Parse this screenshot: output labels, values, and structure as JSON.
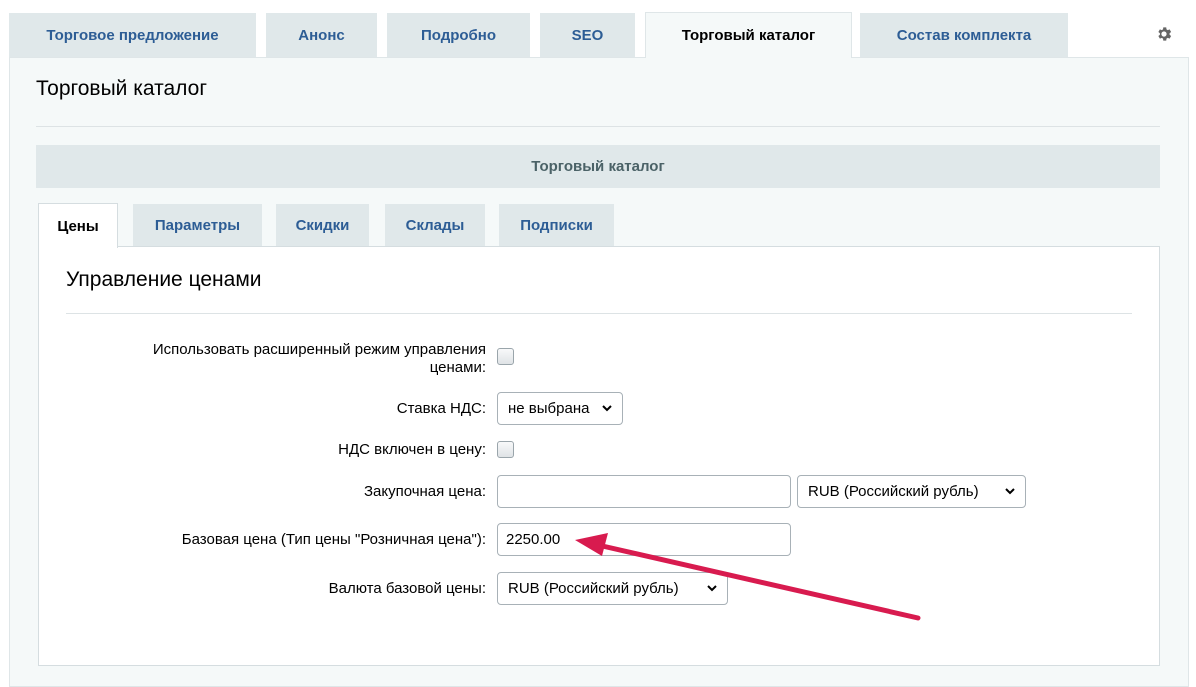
{
  "top_tabs": [
    {
      "label": "Торговое предложение"
    },
    {
      "label": "Анонс"
    },
    {
      "label": "Подробно"
    },
    {
      "label": "SEO"
    },
    {
      "label": "Торговый каталог"
    },
    {
      "label": "Состав комплекта"
    }
  ],
  "active_top_tab": "Торговый каталог",
  "settings_icon": "gear-icon",
  "page_title": "Торговый каталог",
  "section_header": "Торговый каталог",
  "sub_tabs": [
    {
      "label": "Цены"
    },
    {
      "label": "Параметры"
    },
    {
      "label": "Скидки"
    },
    {
      "label": "Склады"
    },
    {
      "label": "Подписки"
    }
  ],
  "active_sub_tab": "Цены",
  "price_section": {
    "title": "Управление ценами",
    "extended_mode": {
      "label_line1": "Использовать расширенный режим управления",
      "label_line2": "ценами:",
      "checked": false
    },
    "vat_rate": {
      "label": "Ставка НДС:",
      "value": "не выбрана"
    },
    "vat_included": {
      "label": "НДС включен в цену:",
      "checked": false
    },
    "purchase_price": {
      "label": "Закупочная цена:",
      "value": "",
      "currency": "RUB (Российский рубль)"
    },
    "base_price": {
      "label": "Базовая цена (Тип цены \"Розничная цена\"):",
      "value": "2250.00"
    },
    "base_currency": {
      "label": "Валюта базовой цены:",
      "value": "RUB (Российский рубль)"
    }
  },
  "colors": {
    "tab_link": "#2d5d95",
    "tab_bg": "#e0e8ea",
    "panel_bg": "#f5f9f9",
    "annotation_arrow": "#d81b4f"
  }
}
